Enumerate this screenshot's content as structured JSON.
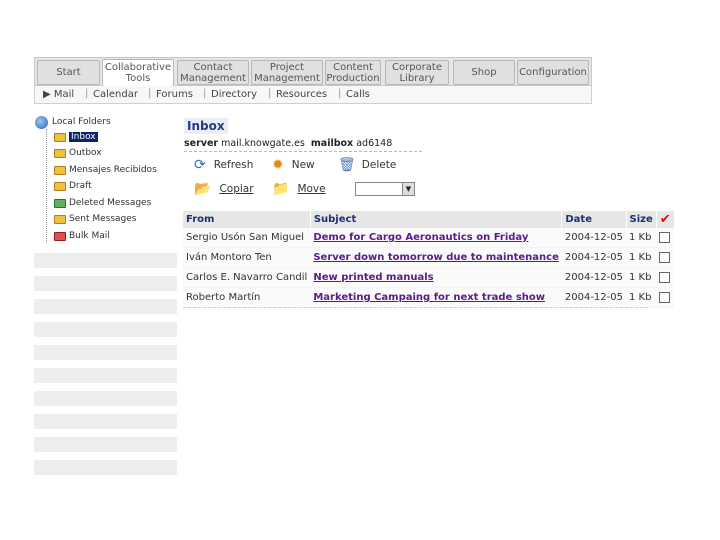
{
  "topnav": {
    "tabs": [
      {
        "label": "Start"
      },
      {
        "label": "Collaborative\nTools"
      },
      {
        "label": "Contact\nManagement"
      },
      {
        "label": "Project\nManagement"
      },
      {
        "label": "Content\nProduction"
      },
      {
        "label": "Corporate\nLibrary"
      },
      {
        "label": "Shop"
      },
      {
        "label": "Configuration"
      }
    ]
  },
  "subnav": {
    "items": [
      "▶ Mail",
      "Calendar",
      "Forums",
      "Directory",
      "Resources",
      "Calls"
    ]
  },
  "sidebar": {
    "root": "Local Folders",
    "folders": [
      {
        "label": "Inbox"
      },
      {
        "label": "Outbox"
      },
      {
        "label": "Mensajes Recibidos"
      },
      {
        "label": "Draft"
      },
      {
        "label": "Deleted Messages"
      },
      {
        "label": "Sent Messages"
      },
      {
        "label": "Bulk Mail"
      }
    ]
  },
  "main": {
    "title": "Inbox",
    "server_label": "server",
    "server_value": "mail.knowgate.es",
    "mailbox_label": "mailbox",
    "mailbox_value": "ad6148",
    "actions": {
      "refresh": "Refresh",
      "new": "New",
      "delete": "Delete",
      "copy": "Copiar",
      "move": "Move"
    },
    "columns": {
      "from": "From",
      "subject": "Subject",
      "date": "Date",
      "size": "Size"
    },
    "messages": [
      {
        "from": "Sergio Usón San Miguel",
        "subject": "Demo for Cargo Aeronautics on Friday",
        "date": "2004-12-05",
        "size": "1 Kb"
      },
      {
        "from": "Iván Montoro Ten",
        "subject": "Server down tomorrow due to maintenance",
        "date": "2004-12-05",
        "size": "1 Kb"
      },
      {
        "from": "Carlos E. Navarro Candil",
        "subject": "New printed manuals",
        "date": "2004-12-05",
        "size": "1 Kb"
      },
      {
        "from": "Roberto Martín",
        "subject": "Marketing Campaing for next trade show",
        "date": "2004-12-05",
        "size": "1 Kb"
      }
    ]
  }
}
